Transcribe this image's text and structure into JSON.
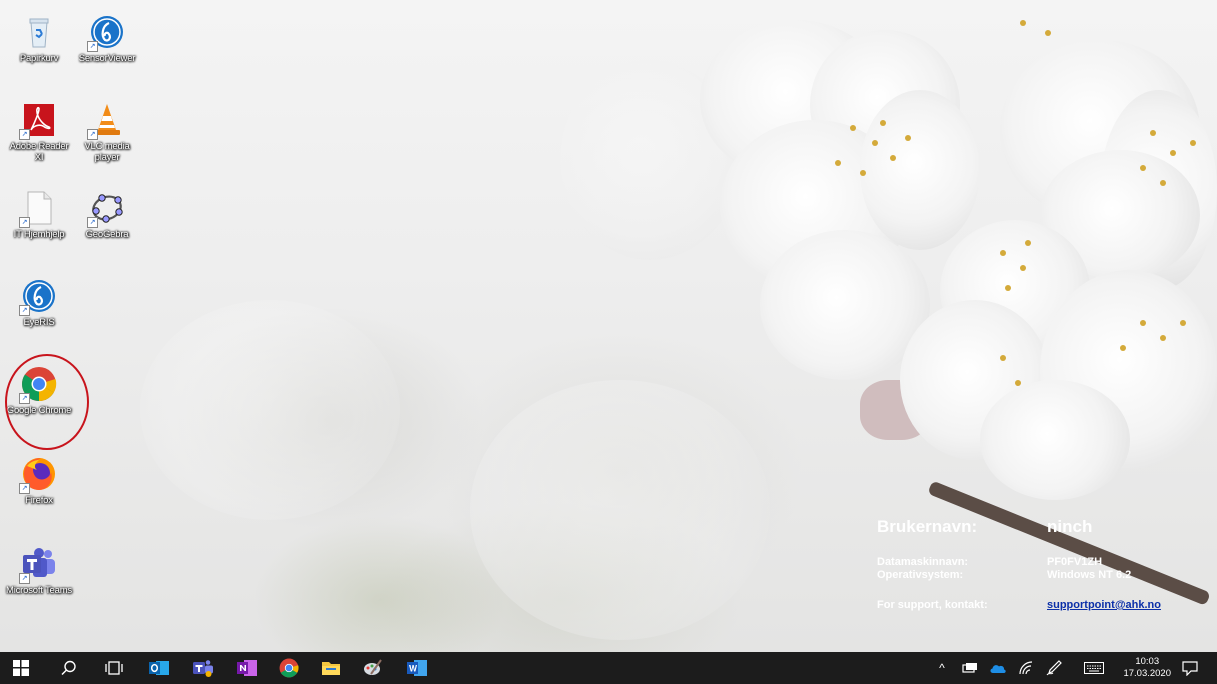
{
  "desktop": {
    "icons": [
      {
        "label": "Papirkurv"
      },
      {
        "label": "SensorViewer"
      },
      {
        "label": "Adobe Reader XI"
      },
      {
        "label": "VLC media player"
      },
      {
        "label": "IT Hjemhjelp"
      },
      {
        "label": "GeoGebra"
      },
      {
        "label": "EyeRIS"
      },
      {
        "label": "Google Chrome"
      },
      {
        "label": "Firefox"
      },
      {
        "label": "Microsoft Teams"
      }
    ]
  },
  "info": {
    "username_label": "Brukernavn:",
    "username_value": "ninch",
    "computer_label": "Datamaskinnavn:",
    "computer_value": "PF0FV1ZH",
    "os_label": "Operativsystem:",
    "os_value": "Windows NT 6.2",
    "support_label": "For support, kontakt:",
    "support_value": "supportpoint@ahk.no"
  },
  "taskbar": {
    "time": "10:03",
    "date": "17.03.2020"
  },
  "colors": {
    "taskbar": "#1c1c1c",
    "highlight": "#c8141c",
    "link": "#0b2fa8"
  }
}
